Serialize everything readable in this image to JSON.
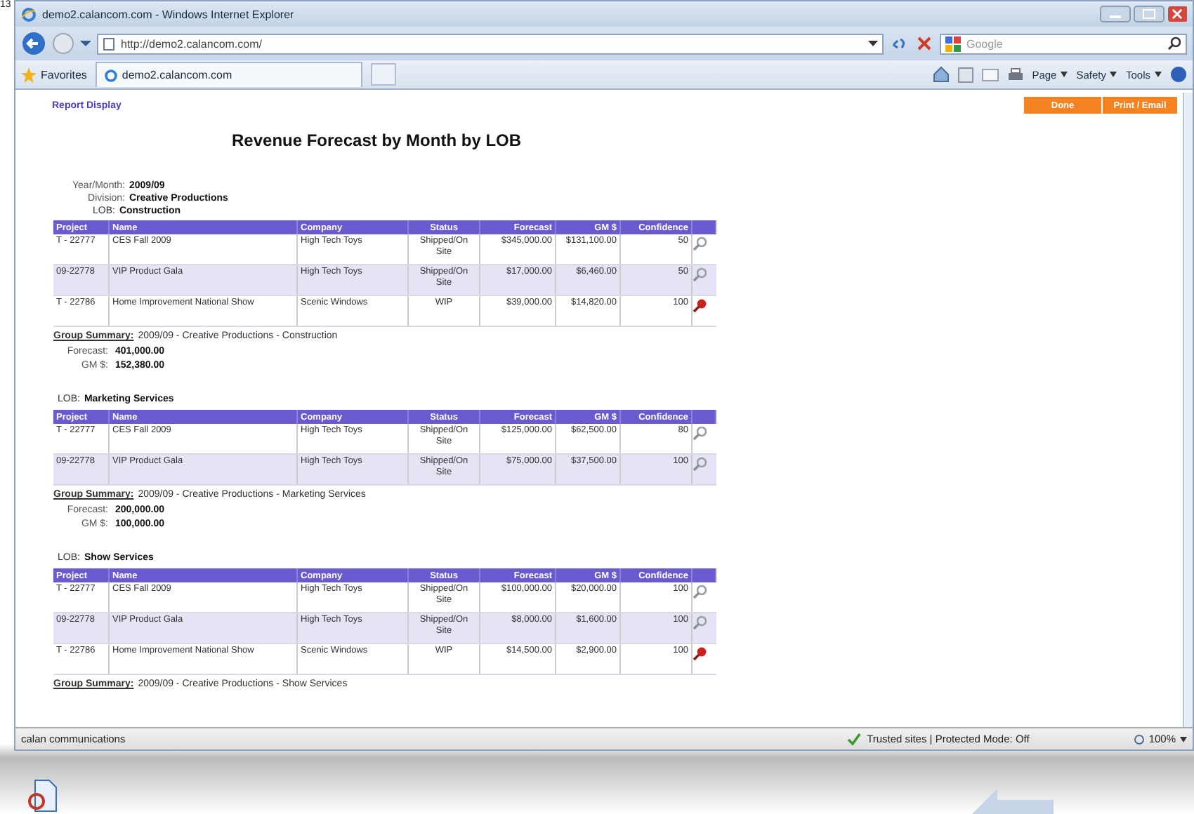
{
  "page_number": "13",
  "window": {
    "title": "demo2.calancom.com - Windows Internet Explorer",
    "address": "http://demo2.calancom.com/",
    "search_placeholder": "Google",
    "favorites": "Favorites",
    "tab": "demo2.calancom.com",
    "commands": [
      "Page",
      "Safety",
      "Tools"
    ]
  },
  "report": {
    "nav_label": "Report Display",
    "buttons": [
      "Done",
      "Print / Email"
    ],
    "title": "Revenue Forecast by Month by LOB",
    "meta": [
      {
        "label": "Year/Month:",
        "value": "2009/09"
      },
      {
        "label": "Division:",
        "value": "Creative Productions"
      }
    ],
    "groups": [
      {
        "lob_label": "LOB:",
        "lob": "Construction",
        "columns": [
          "Project",
          "Name",
          "Company",
          "Status",
          "Forecast",
          "GM $",
          "Confidence"
        ],
        "rows": [
          {
            "project": "T - 22777",
            "name": "CES Fall 2009",
            "company": "High Tech Toys",
            "status": "Shipped/On Site",
            "forecast": "$345,000.00",
            "gm": "$131,100.00",
            "confidence": "50",
            "kind": "view"
          },
          {
            "project": "09-22778",
            "name": "VIP Product Gala",
            "company": "High Tech Toys",
            "status": "Shipped/On Site",
            "forecast": "$17,000.00",
            "gm": "$6,460.00",
            "confidence": "50",
            "kind": "view"
          },
          {
            "project": "T - 22786",
            "name": "Home Improvement National Show",
            "company": "Scenic Windows",
            "status": "WIP",
            "forecast": "$39,000.00",
            "gm": "$14,820.00",
            "confidence": "100",
            "kind": "pin"
          }
        ],
        "summary_label": "Group Summary:",
        "summary": "2009/09 - Creative Productions - Construction",
        "totals": [
          {
            "label": "Forecast:",
            "value": "401,000.00"
          },
          {
            "label": "GM $:",
            "value": "152,380.00"
          }
        ]
      },
      {
        "lob_label": "LOB:",
        "lob": "Marketing Services",
        "columns": [
          "Project",
          "Name",
          "Company",
          "Status",
          "Forecast",
          "GM $",
          "Confidence"
        ],
        "rows": [
          {
            "project": "T - 22777",
            "name": "CES Fall 2009",
            "company": "High Tech Toys",
            "status": "Shipped/On Site",
            "forecast": "$125,000.00",
            "gm": "$62,500.00",
            "confidence": "80",
            "kind": "view"
          },
          {
            "project": "09-22778",
            "name": "VIP Product Gala",
            "company": "High Tech Toys",
            "status": "Shipped/On Site",
            "forecast": "$75,000.00",
            "gm": "$37,500.00",
            "confidence": "100",
            "kind": "view"
          }
        ],
        "summary_label": "Group Summary:",
        "summary": "2009/09 - Creative Productions - Marketing Services",
        "totals": [
          {
            "label": "Forecast:",
            "value": "200,000.00"
          },
          {
            "label": "GM $:",
            "value": "100,000.00"
          }
        ]
      },
      {
        "lob_label": "LOB:",
        "lob": "Show Services",
        "columns": [
          "Project",
          "Name",
          "Company",
          "Status",
          "Forecast",
          "GM $",
          "Confidence"
        ],
        "rows": [
          {
            "project": "T - 22777",
            "name": "CES Fall 2009",
            "company": "High Tech Toys",
            "status": "Shipped/On Site",
            "forecast": "$100,000.00",
            "gm": "$20,000.00",
            "confidence": "100",
            "kind": "view"
          },
          {
            "project": "09-22778",
            "name": "VIP Product Gala",
            "company": "High Tech Toys",
            "status": "Shipped/On Site",
            "forecast": "$8,000.00",
            "gm": "$1,600.00",
            "confidence": "100",
            "kind": "view"
          },
          {
            "project": "T - 22786",
            "name": "Home Improvement National Show",
            "company": "Scenic Windows",
            "status": "WIP",
            "forecast": "$14,500.00",
            "gm": "$2,900.00",
            "confidence": "100",
            "kind": "pin"
          }
        ],
        "summary_label": "Group Summary:",
        "summary": "2009/09 - Creative Productions - Show Services"
      }
    ]
  },
  "status_bar": {
    "left": "calan communications",
    "zone": "Trusted sites | Protected Mode: Off",
    "zoom": "100%"
  }
}
